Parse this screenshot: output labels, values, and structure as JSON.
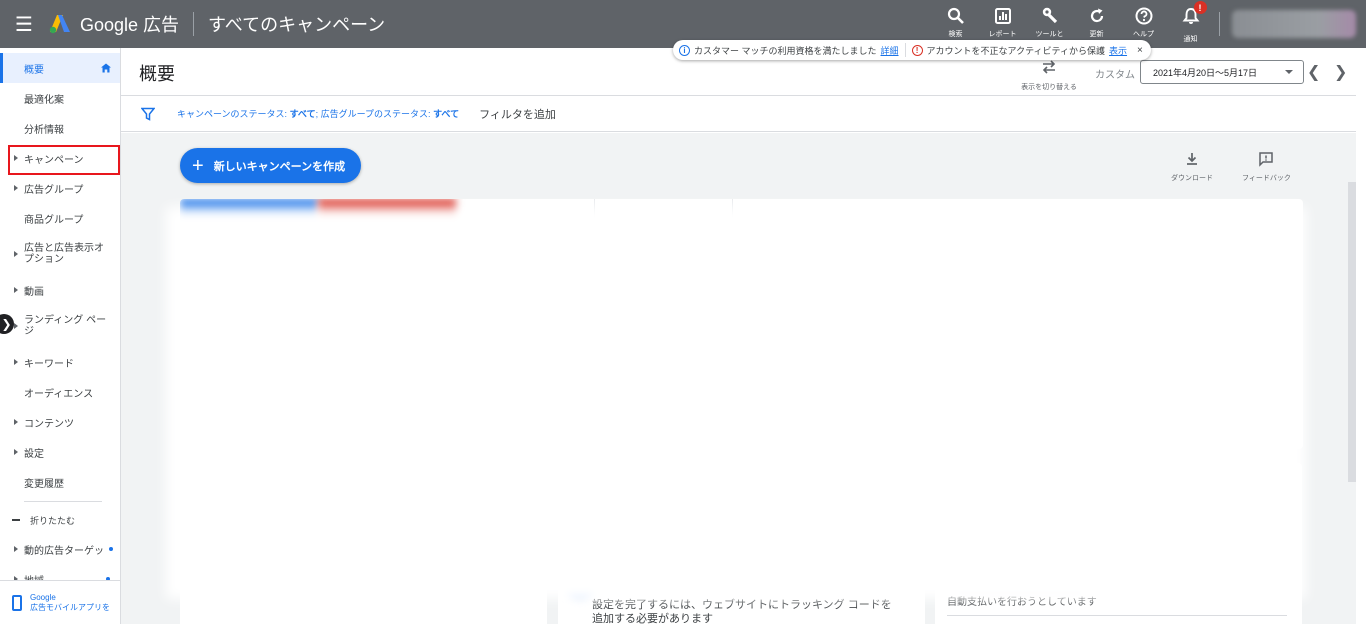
{
  "app": {
    "brand": "Google 広告",
    "page_heading": "すべてのキャンペーン"
  },
  "toolbar": [
    {
      "name": "search",
      "label": "検索",
      "icon": "search-icon"
    },
    {
      "name": "report",
      "label": "レポート",
      "icon": "report-icon"
    },
    {
      "name": "tools",
      "label": "ツールと",
      "icon": "wrench-icon"
    },
    {
      "name": "refresh",
      "label": "更新",
      "icon": "refresh-icon"
    },
    {
      "name": "help",
      "label": "ヘルプ",
      "icon": "help-icon"
    },
    {
      "name": "notifications",
      "label": "通知",
      "icon": "bell-icon",
      "badge": "!"
    }
  ],
  "notices": {
    "info_text": "カスタマー マッチの利用資格を満たしました",
    "info_link": "詳細",
    "warn_text": "アカウントを不正なアクティビティから保護",
    "warn_link": "表示",
    "close": "×"
  },
  "sidebar": {
    "items": [
      {
        "label": "概要",
        "active": true,
        "caret": false
      },
      {
        "label": "最適化案",
        "caret": false
      },
      {
        "label": "分析情報",
        "caret": false
      },
      {
        "label": "キャンペーン",
        "caret": true,
        "highlight": true
      },
      {
        "label": "広告グループ",
        "caret": true
      },
      {
        "label": "商品グループ",
        "caret": false
      },
      {
        "label": "広告と広告表示オプション",
        "caret": true,
        "two_line": true
      },
      {
        "label": "動画",
        "caret": true
      },
      {
        "label": "ランディング ページ",
        "caret": true,
        "two_line": true
      },
      {
        "label": "キーワード",
        "caret": true
      },
      {
        "label": "オーディエンス",
        "caret": false
      },
      {
        "label": "コンテンツ",
        "caret": true
      },
      {
        "label": "設定",
        "caret": true
      },
      {
        "label": "変更履歴",
        "caret": false
      }
    ],
    "collapse_label": "折りたたむ",
    "extra_items": [
      {
        "label": "動的広告ターゲッ",
        "dot": true
      },
      {
        "label": "地域",
        "dot": true
      }
    ],
    "mobile_app_line1": "Google",
    "mobile_app_line2": "広告モバイルアプリを"
  },
  "header": {
    "title": "概要",
    "switch_view_label": "表示を切り替える",
    "custom_label": "カスタム",
    "date_range": "2021年4月20日～5月17日"
  },
  "filters": {
    "campaign_status_label": "キャンペーンのステータス: ",
    "campaign_status_value": "すべて",
    "separator": "; ",
    "adgroup_status_label": "広告グループのステータス: ",
    "adgroup_status_value": "すべて",
    "add_filter": "フィルタを追加"
  },
  "content": {
    "new_campaign_button": "新しいキャンペーンを作成",
    "download_label": "ダウンロード",
    "feedback_label": "フィードバック",
    "bottom_mid_line1": "設定を完了するには、ウェブサイトにトラッキング コードを",
    "bottom_mid_line2": "追加する必要があります",
    "bottom_right_line1": "自動支払いを行おうとしています"
  },
  "colors": {
    "topbar": "#5f6368",
    "accent": "#1a73e8",
    "alert": "#d93025",
    "highlight_box": "#e8161d"
  }
}
